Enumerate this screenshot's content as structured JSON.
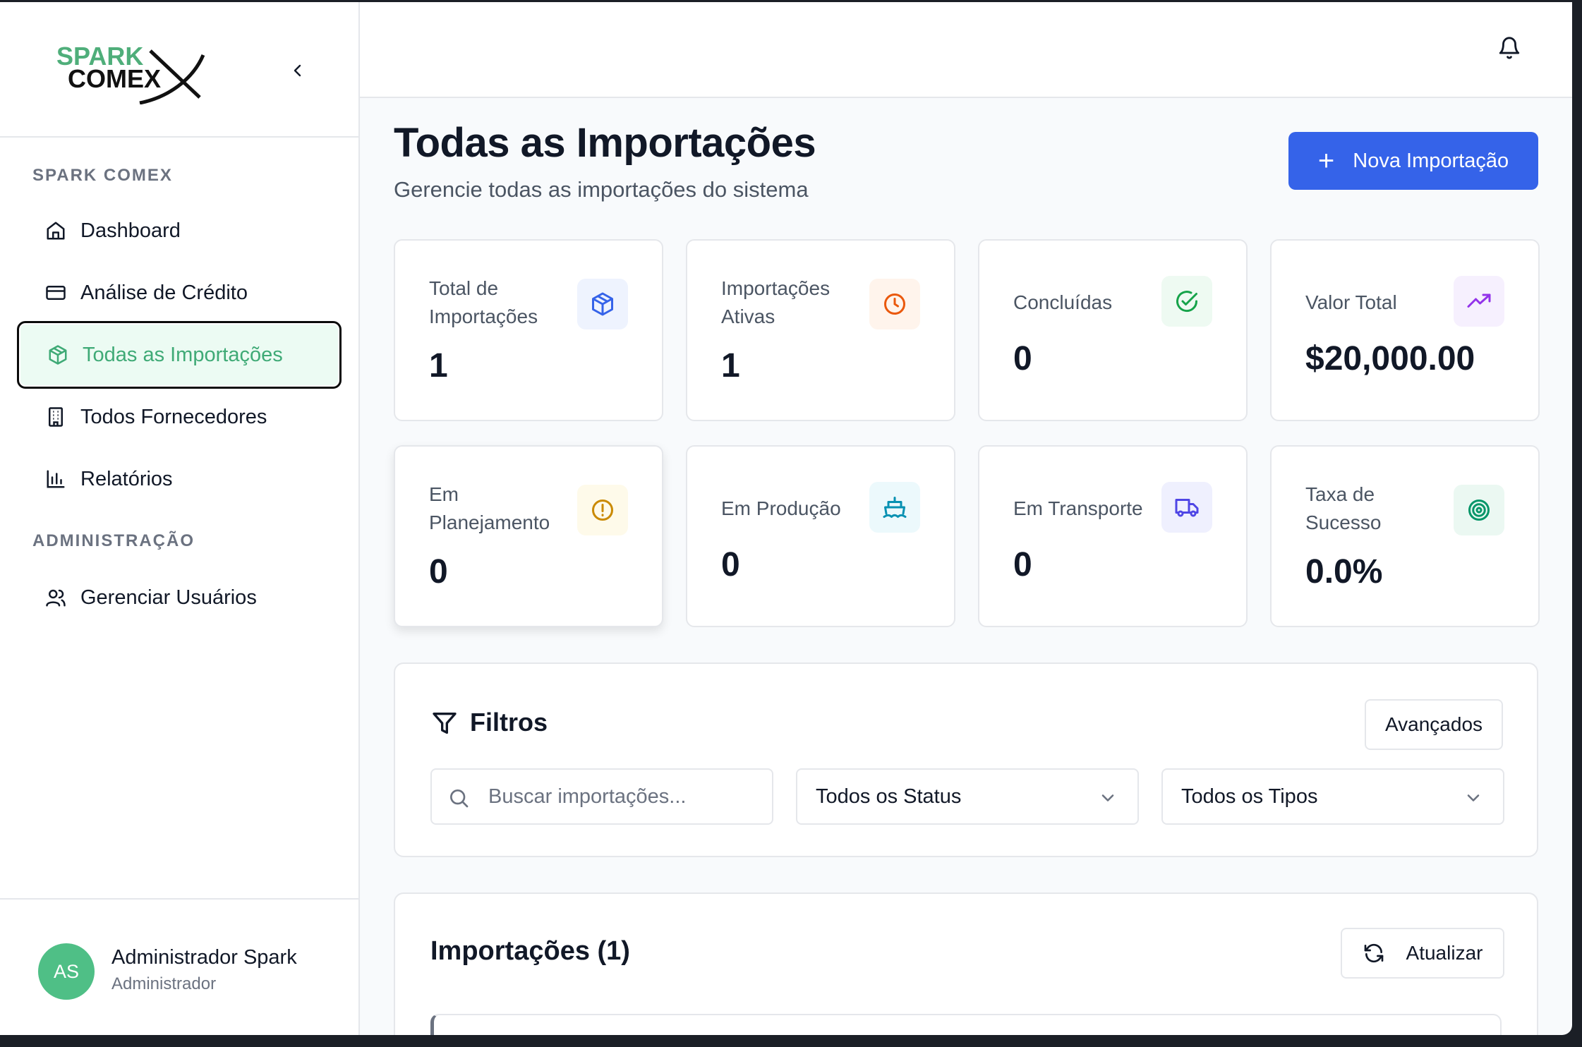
{
  "app": {
    "logo_text_top": "SPARK",
    "logo_text_bottom": "COMEX"
  },
  "sidebar": {
    "section_main": "SPARK COMEX",
    "section_admin": "ADMINISTRAÇÃO",
    "items": [
      {
        "label": "Dashboard",
        "icon": "home-icon"
      },
      {
        "label": "Análise de Crédito",
        "icon": "credit-card-icon"
      },
      {
        "label": "Todas as Importações",
        "icon": "package-icon",
        "active": true
      },
      {
        "label": "Todos Fornecedores",
        "icon": "building-icon"
      },
      {
        "label": "Relatórios",
        "icon": "bar-chart-icon"
      }
    ],
    "admin_items": [
      {
        "label": "Gerenciar Usuários",
        "icon": "users-icon"
      }
    ],
    "user": {
      "initials": "AS",
      "name": "Administrador Spark",
      "role": "Administrador"
    }
  },
  "header": {
    "title": "Todas as Importações",
    "subtitle": "Gerencie todas as importações do sistema",
    "new_button": "Nova Importação"
  },
  "stats": [
    {
      "label": "Total de Importações",
      "value": "1",
      "icon": "package-icon",
      "color": "#3563e9",
      "bg": "#eef3fe"
    },
    {
      "label": "Importações Ativas",
      "value": "1",
      "icon": "clock-icon",
      "color": "#ea580c",
      "bg": "#fff4ec"
    },
    {
      "label": "Concluídas",
      "value": "0",
      "icon": "check-circle-icon",
      "color": "#16a34a",
      "bg": "#eefaf2"
    },
    {
      "label": "Valor Total",
      "value": "$20,000.00",
      "icon": "trending-up-icon",
      "color": "#9333ea",
      "bg": "#f6f0fe"
    },
    {
      "label": "Em Planejamento",
      "value": "0",
      "icon": "alert-circle-icon",
      "color": "#ca8a04",
      "bg": "#fefaea"
    },
    {
      "label": "Em Produção",
      "value": "0",
      "icon": "ship-icon",
      "color": "#0891b2",
      "bg": "#ecf9fc"
    },
    {
      "label": "Em Transporte",
      "value": "0",
      "icon": "truck-icon",
      "color": "#4f46e5",
      "bg": "#eff0fe"
    },
    {
      "label": "Taxa de Sucesso",
      "value": "0.0%",
      "icon": "target-icon",
      "color": "#059669",
      "bg": "#ebf8f2"
    }
  ],
  "filters": {
    "title": "Filtros",
    "advanced_button": "Avançados",
    "search_placeholder": "Buscar importações...",
    "status_select": "Todos os Status",
    "type_select": "Todos os Tipos"
  },
  "imports": {
    "title": "Importações (1)",
    "refresh_button": "Atualizar"
  }
}
